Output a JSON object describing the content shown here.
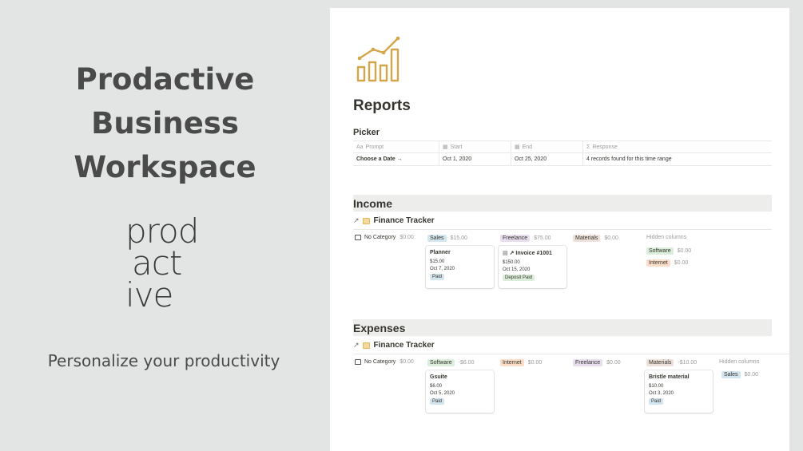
{
  "promo": {
    "title_lines": [
      "Prodactive",
      "Business",
      "Workspace"
    ],
    "logo_lines": [
      "prod",
      "act",
      "ive"
    ],
    "tagline": "Personalize your productivity"
  },
  "colors": {
    "background": "#e3e5e5",
    "icon_gold": "#d4a64a",
    "section_bg": "#ededec"
  },
  "page": {
    "icon": "bar-chart-line-icon",
    "title": "Reports",
    "picker": {
      "title": "Picker",
      "headers": [
        {
          "icon": "text-icon",
          "glyph": "Aa",
          "label": "Prompt"
        },
        {
          "icon": "calendar-icon",
          "glyph": "▦",
          "label": "Start"
        },
        {
          "icon": "calendar-icon",
          "glyph": "▦",
          "label": "End"
        },
        {
          "icon": "sigma-icon",
          "glyph": "Σ",
          "label": "Response"
        }
      ],
      "row": [
        "Choose a Date →",
        "Oct 1, 2020",
        "Oct 25, 2020",
        "4 records found for this time range"
      ]
    },
    "income": {
      "title": "Income",
      "db_title": "Finance Tracker",
      "groups": [
        {
          "label": "No Category",
          "amount": "$0.00"
        },
        {
          "label": "Sales",
          "amount": "$15.00"
        },
        {
          "label": "Freelance",
          "amount": "$75.00"
        },
        {
          "label": "Materials",
          "amount": "$0.00"
        },
        {
          "label": "Hidden columns",
          "amount": ""
        }
      ],
      "hidden": [
        {
          "label": "Software",
          "amount": "$0.00"
        },
        {
          "label": "Internet",
          "amount": "$0.00"
        }
      ],
      "cards": [
        {
          "title": "Planner",
          "amount": "$15.00",
          "date": "Oct 7, 2020",
          "status": "Paid"
        },
        {
          "title": "↗ Invoice #1001",
          "amount": "$150.00",
          "date": "Oct 15, 2020",
          "status": "Deposit Paid"
        }
      ]
    },
    "expenses": {
      "title": "Expenses",
      "db_title": "Finance Tracker",
      "groups": [
        {
          "label": "No Category",
          "amount": "$0.00"
        },
        {
          "label": "Software",
          "amount": "-$6.00"
        },
        {
          "label": "Internet",
          "amount": "$0.00"
        },
        {
          "label": "Freelance",
          "amount": "$0.00"
        },
        {
          "label": "Materials",
          "amount": "-$10.00"
        },
        {
          "label": "Hidden columns",
          "amount": ""
        }
      ],
      "hidden": [
        {
          "label": "Sales",
          "amount": "$0.00"
        }
      ],
      "cards": [
        {
          "title": "Gsuite",
          "amount": "$6.00",
          "date": "Oct 5, 2020",
          "status": "Paid"
        },
        {
          "title": "Bristle material",
          "amount": "$10.00",
          "date": "Oct 3, 2020",
          "status": "Paid"
        }
      ]
    }
  }
}
